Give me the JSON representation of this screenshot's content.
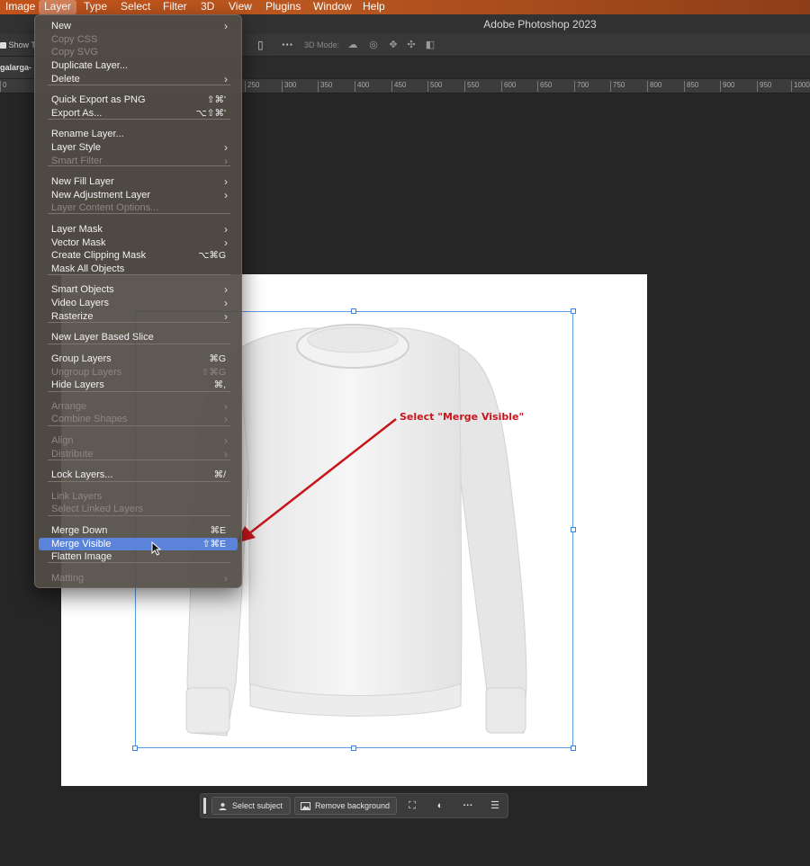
{
  "menubar": {
    "items": [
      "Image",
      "Layer",
      "Type",
      "Select",
      "Filter",
      "3D",
      "View",
      "Plugins",
      "Window",
      "Help"
    ],
    "active": "Layer"
  },
  "titlebar": {
    "title": "Adobe Photoshop 2023"
  },
  "optionsbar": {
    "show_transform_label": "Show T",
    "mode_label": "3D Mode:"
  },
  "doctab": {
    "label": "galarga-"
  },
  "ruler": {
    "ticks": [
      "0",
      "250",
      "300",
      "350",
      "400",
      "450",
      "500",
      "550",
      "600",
      "650",
      "700",
      "750",
      "800",
      "850",
      "900",
      "950",
      "1000"
    ]
  },
  "layer_menu": {
    "items": [
      {
        "label": "New",
        "shortcut": "",
        "submenu": true,
        "disabled": false
      },
      {
        "label": "Copy CSS",
        "shortcut": "",
        "submenu": false,
        "disabled": true
      },
      {
        "label": "Copy SVG",
        "shortcut": "",
        "submenu": false,
        "disabled": true
      },
      {
        "label": "Duplicate Layer...",
        "shortcut": "",
        "submenu": false,
        "disabled": false
      },
      {
        "label": "Delete",
        "shortcut": "",
        "submenu": true,
        "disabled": false
      },
      {
        "label": "Quick Export as PNG",
        "shortcut": "⇧⌘'",
        "submenu": false,
        "disabled": false
      },
      {
        "label": "Export As...",
        "shortcut": "⌥⇧⌘'",
        "submenu": false,
        "disabled": false
      },
      {
        "label": "Rename Layer...",
        "shortcut": "",
        "submenu": false,
        "disabled": false
      },
      {
        "label": "Layer Style",
        "shortcut": "",
        "submenu": true,
        "disabled": false
      },
      {
        "label": "Smart Filter",
        "shortcut": "",
        "submenu": true,
        "disabled": true
      },
      {
        "label": "New Fill Layer",
        "shortcut": "",
        "submenu": true,
        "disabled": false
      },
      {
        "label": "New Adjustment Layer",
        "shortcut": "",
        "submenu": true,
        "disabled": false
      },
      {
        "label": "Layer Content Options...",
        "shortcut": "",
        "submenu": false,
        "disabled": true
      },
      {
        "label": "Layer Mask",
        "shortcut": "",
        "submenu": true,
        "disabled": false
      },
      {
        "label": "Vector Mask",
        "shortcut": "",
        "submenu": true,
        "disabled": false
      },
      {
        "label": "Create Clipping Mask",
        "shortcut": "⌥⌘G",
        "submenu": false,
        "disabled": false
      },
      {
        "label": "Mask All Objects",
        "shortcut": "",
        "submenu": false,
        "disabled": false
      },
      {
        "label": "Smart Objects",
        "shortcut": "",
        "submenu": true,
        "disabled": false
      },
      {
        "label": "Video Layers",
        "shortcut": "",
        "submenu": true,
        "disabled": false
      },
      {
        "label": "Rasterize",
        "shortcut": "",
        "submenu": true,
        "disabled": false
      },
      {
        "label": "New Layer Based Slice",
        "shortcut": "",
        "submenu": false,
        "disabled": false
      },
      {
        "label": "Group Layers",
        "shortcut": "⌘G",
        "submenu": false,
        "disabled": false
      },
      {
        "label": "Ungroup Layers",
        "shortcut": "⇧⌘G",
        "submenu": false,
        "disabled": true
      },
      {
        "label": "Hide Layers",
        "shortcut": "⌘,",
        "submenu": false,
        "disabled": false
      },
      {
        "label": "Arrange",
        "shortcut": "",
        "submenu": true,
        "disabled": true
      },
      {
        "label": "Combine Shapes",
        "shortcut": "",
        "submenu": true,
        "disabled": true
      },
      {
        "label": "Align",
        "shortcut": "",
        "submenu": true,
        "disabled": true
      },
      {
        "label": "Distribute",
        "shortcut": "",
        "submenu": true,
        "disabled": true
      },
      {
        "label": "Lock Layers...",
        "shortcut": "⌘/",
        "submenu": false,
        "disabled": false
      },
      {
        "label": "Link Layers",
        "shortcut": "",
        "submenu": false,
        "disabled": true
      },
      {
        "label": "Select Linked Layers",
        "shortcut": "",
        "submenu": false,
        "disabled": true
      },
      {
        "label": "Merge Down",
        "shortcut": "⌘E",
        "submenu": false,
        "disabled": false
      },
      {
        "label": "Merge Visible",
        "shortcut": "⇧⌘E",
        "submenu": false,
        "disabled": false,
        "highlighted": true
      },
      {
        "label": "Flatten Image",
        "shortcut": "",
        "submenu": false,
        "disabled": false
      },
      {
        "label": "Matting",
        "shortcut": "",
        "submenu": true,
        "disabled": true
      }
    ]
  },
  "annotation": {
    "text": "Select \"Merge Visible\"",
    "color": "#c8161d"
  },
  "taskbar": {
    "select_subject_label": "Select subject",
    "remove_background_label": "Remove background"
  },
  "colors": {
    "menu_highlight": "#5a83d9",
    "selection_box": "#5c9be6",
    "menubar_accent": "#c2521c"
  }
}
